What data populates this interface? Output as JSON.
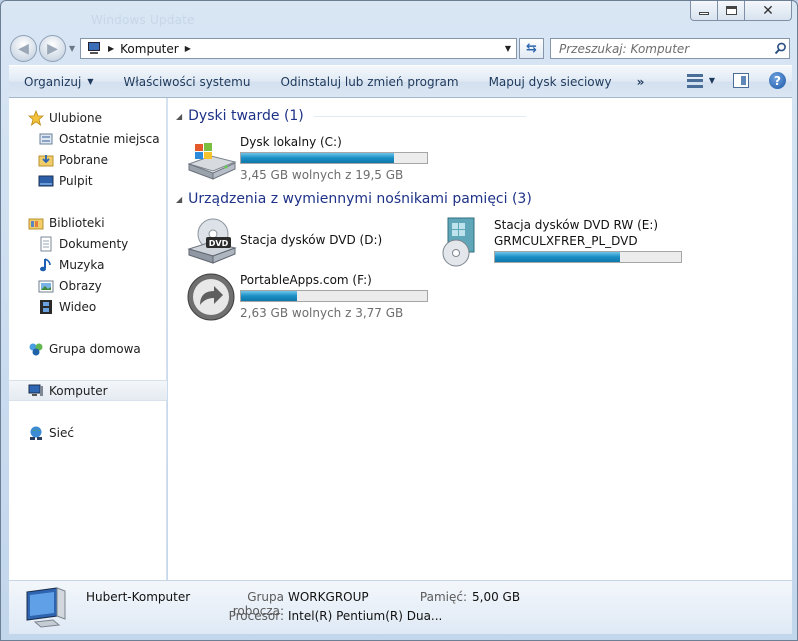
{
  "window": {
    "ghost_title": "Windows Update",
    "buttons": {
      "minimize": "minimize",
      "maximize": "maximize",
      "close": "✕"
    }
  },
  "address": {
    "crumb": "Komputer",
    "search_placeholder": "Przeszukaj: Komputer"
  },
  "toolbar": {
    "items": [
      "Organizuj",
      "Właściwości systemu",
      "Odinstaluj lub zmień program",
      "Mapuj dysk sieciowy"
    ],
    "more": "»",
    "help": "?"
  },
  "nav": {
    "favorites": "Ulubione",
    "recent": "Ostatnie miejsca",
    "downloads": "Pobrane",
    "desktop": "Pulpit",
    "libraries": "Biblioteki",
    "documents": "Dokumenty",
    "music": "Muzyka",
    "pictures": "Obrazy",
    "videos": "Wideo",
    "homegroup": "Grupa domowa",
    "computer": "Komputer",
    "network": "Sieć"
  },
  "groups": {
    "hard_disks": "Dyski twarde (1)",
    "removable": "Urządzenia z wymiennymi nośnikami pamięci (3)"
  },
  "drives": {
    "c": {
      "name": "Dysk lokalny (C:)",
      "free": "3,45 GB wolnych z 19,5 GB",
      "used_fraction": 0.823
    },
    "d": {
      "name": "Stacja dysków DVD (D:)"
    },
    "e": {
      "name": "Stacja dysków DVD RW (E:)",
      "label": "GRMCULXFRER_PL_DVD",
      "used_fraction": 0.67
    },
    "f": {
      "name": "PortableApps.com (F:)",
      "free": "2,63 GB wolnych z 3,77 GB",
      "used_fraction": 0.302
    }
  },
  "details": {
    "computer_name": "Hubert-Komputer",
    "workgroup_label": "Grupa robocza:",
    "workgroup_value": "WORKGROUP",
    "memory_label": "Pamięć:",
    "memory_value": "5,00 GB",
    "processor_label": "Procesor:",
    "processor_value": "Intel(R) Pentium(R) Dua..."
  },
  "colors": {
    "accent": "#1a8ec4",
    "group_title": "#1e3287",
    "toolbar_text": "#1e395b"
  }
}
